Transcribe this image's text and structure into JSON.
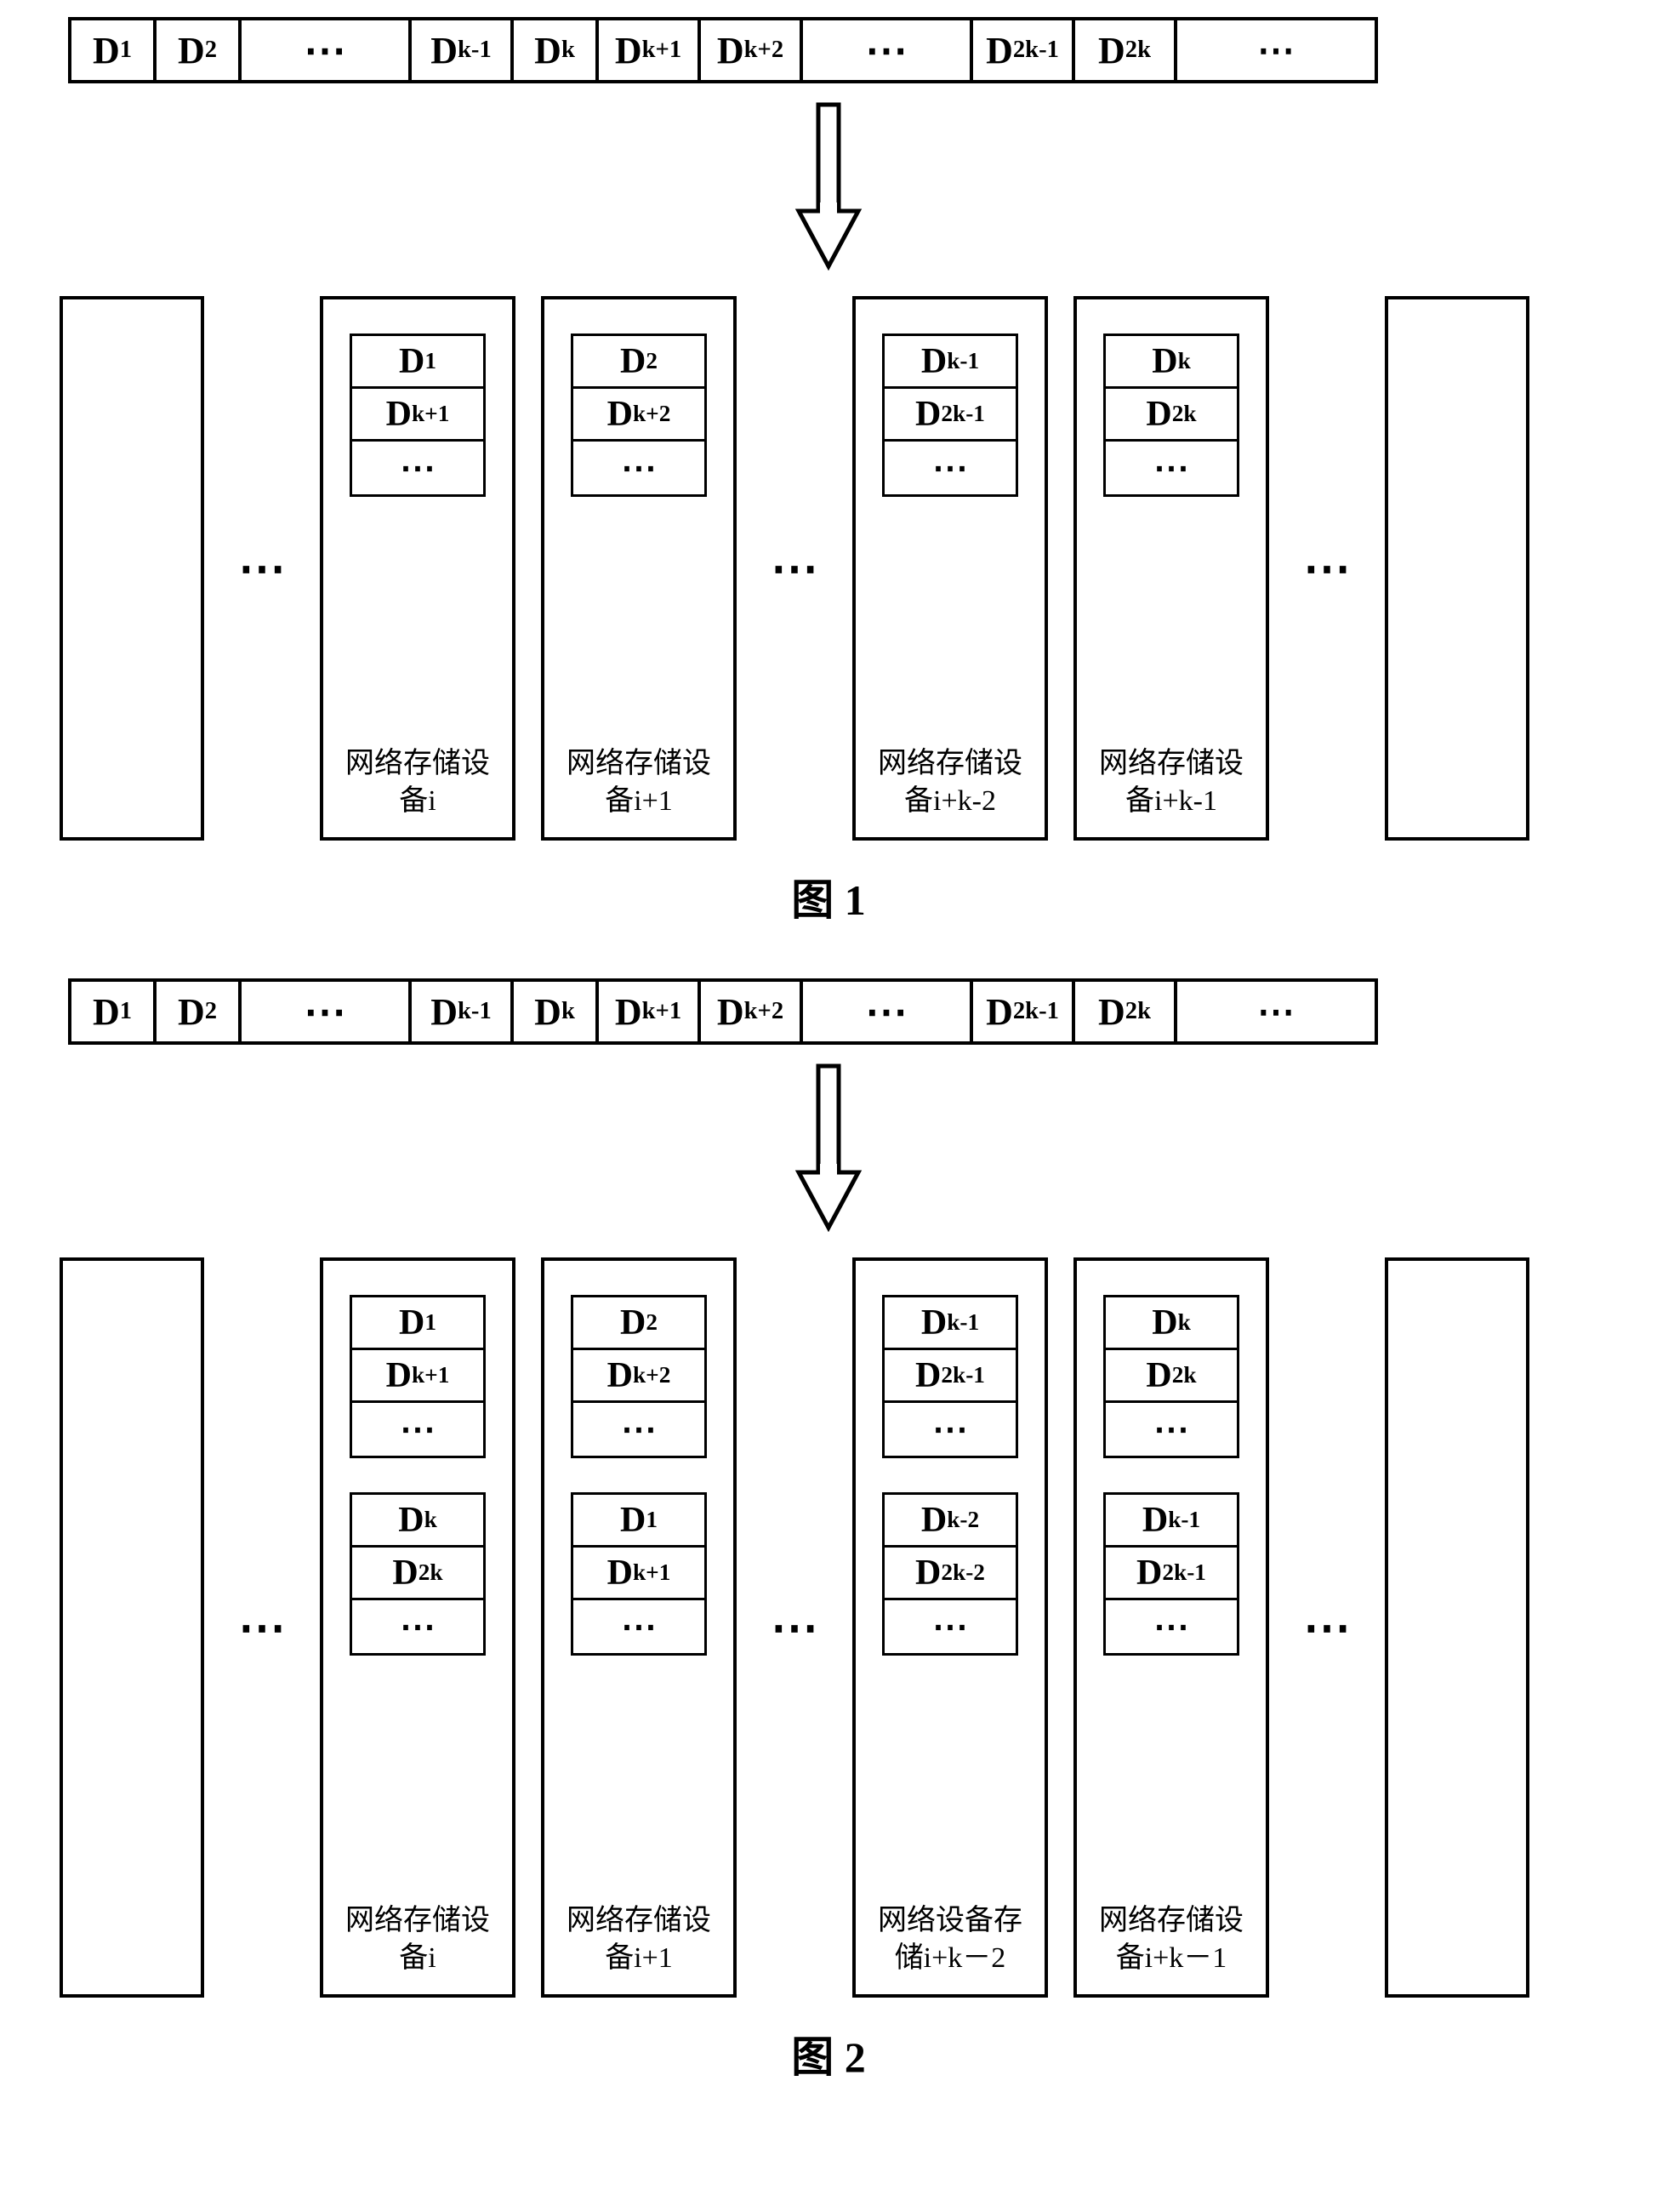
{
  "figure1": {
    "top_row": [
      "D_1",
      "D_2",
      "…",
      "D_k-1",
      "D_k",
      "D_k+1",
      "D_k+2",
      "…",
      "D_2k-1",
      "D_2k",
      "…"
    ],
    "devices": [
      {
        "blocks": [
          "D_1",
          "D_k+1",
          "…"
        ],
        "label": "网络存储设备i"
      },
      {
        "blocks": [
          "D_2",
          "D_k+2",
          "…"
        ],
        "label": "网络存储设备i+1"
      },
      {
        "blocks": [
          "D_k-1",
          "D_2k-1",
          "…"
        ],
        "label": "网络存储设备i+k-2"
      },
      {
        "blocks": [
          "D_k",
          "D_2k",
          "…"
        ],
        "label": "网络存储设备i+k-1"
      }
    ],
    "gap": "…",
    "caption": "图 1"
  },
  "figure2": {
    "top_row": [
      "D_1",
      "D_2",
      "…",
      "D_k-1",
      "D_k",
      "D_k+1",
      "D_k+2",
      "…",
      "D_2k-1",
      "D_2k",
      "…"
    ],
    "devices": [
      {
        "blocks1": [
          "D_1",
          "D_k+1",
          "…"
        ],
        "blocks2": [
          "D_k",
          "D_2k",
          "…"
        ],
        "label": "网络存储设备i"
      },
      {
        "blocks1": [
          "D_2",
          "D_k+2",
          "…"
        ],
        "blocks2": [
          "D_1",
          "D_k+1",
          "…"
        ],
        "label": "网络存储设备i+1"
      },
      {
        "blocks1": [
          "D_k-1",
          "D_2k-1",
          "…"
        ],
        "blocks2": [
          "D_k-2",
          "D_2k-2",
          "…"
        ],
        "label": "网络设备存储i+k－2"
      },
      {
        "blocks1": [
          "D_k",
          "D_2k",
          "…"
        ],
        "blocks2": [
          "D_k-1",
          "D_2k-1",
          "…"
        ],
        "label": "网络存储设备i+k－1"
      }
    ],
    "gap": "…",
    "caption": "图 2"
  }
}
